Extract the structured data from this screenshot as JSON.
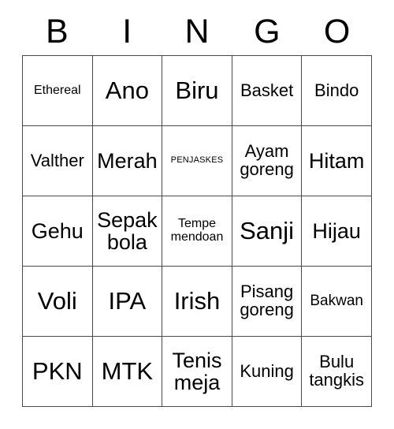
{
  "card": {
    "header_letters": [
      "B",
      "I",
      "N",
      "G",
      "O"
    ],
    "rows": [
      [
        {
          "text": "Ethereal",
          "size": "fs-xs"
        },
        {
          "text": "Ano",
          "size": "fs-xl"
        },
        {
          "text": "Biru",
          "size": "fs-xl"
        },
        {
          "text": "Basket",
          "size": "fs-m"
        },
        {
          "text": "Bindo",
          "size": "fs-m"
        }
      ],
      [
        {
          "text": "Valther",
          "size": "fs-m"
        },
        {
          "text": "Merah",
          "size": "fs-l"
        },
        {
          "text": "PENJASKES",
          "size": "fs-xxs"
        },
        {
          "text": "Ayam goreng",
          "size": "fs-m"
        },
        {
          "text": "Hitam",
          "size": "fs-l"
        }
      ],
      [
        {
          "text": "Gehu",
          "size": "fs-l"
        },
        {
          "text": "Sepak bola",
          "size": "fs-l"
        },
        {
          "text": "Tempe mendoan",
          "size": "fs-xs"
        },
        {
          "text": "Sanji",
          "size": "fs-xl"
        },
        {
          "text": "Hijau",
          "size": "fs-l"
        }
      ],
      [
        {
          "text": "Voli",
          "size": "fs-xl"
        },
        {
          "text": "IPA",
          "size": "fs-xl"
        },
        {
          "text": "Irish",
          "size": "fs-xl"
        },
        {
          "text": "Pisang goreng",
          "size": "fs-m"
        },
        {
          "text": "Bakwan",
          "size": "fs-s"
        }
      ],
      [
        {
          "text": "PKN",
          "size": "fs-xl"
        },
        {
          "text": "MTK",
          "size": "fs-xl"
        },
        {
          "text": "Tenis meja",
          "size": "fs-l"
        },
        {
          "text": "Kuning",
          "size": "fs-m"
        },
        {
          "text": "Bulu tangkis",
          "size": "fs-m"
        }
      ]
    ]
  }
}
